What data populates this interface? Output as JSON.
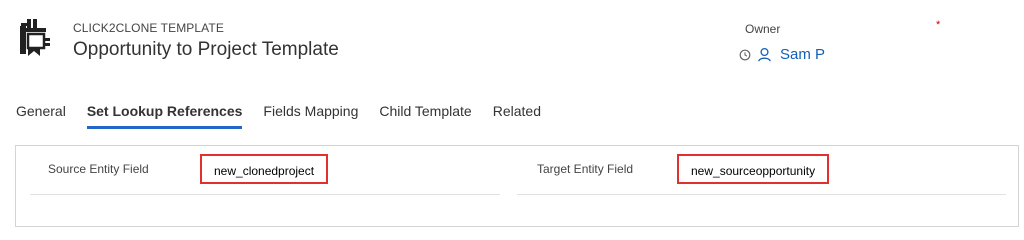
{
  "header": {
    "entity_type": "CLICK2CLONE TEMPLATE",
    "title": "Opportunity to Project Template",
    "owner_label": "Owner",
    "required_mark": "*",
    "owner_name": "Sam P",
    "icons": [
      "clone-template-icon",
      "clock-icon",
      "user-icon"
    ]
  },
  "tabs": [
    {
      "label": "General",
      "active": false
    },
    {
      "label": "Set Lookup References",
      "active": true
    },
    {
      "label": "Fields Mapping",
      "active": false
    },
    {
      "label": "Child Template",
      "active": false
    },
    {
      "label": "Related",
      "active": false
    }
  ],
  "fields": {
    "source": {
      "label": "Source Entity Field",
      "value": "new_clonedproject"
    },
    "target": {
      "label": "Target Entity Field",
      "value": "new_sourceopportunity"
    }
  },
  "colors": {
    "accent": "#2266c8",
    "owner_link": "#1160b7",
    "highlight_border": "#e03030",
    "required": "#c00000"
  }
}
